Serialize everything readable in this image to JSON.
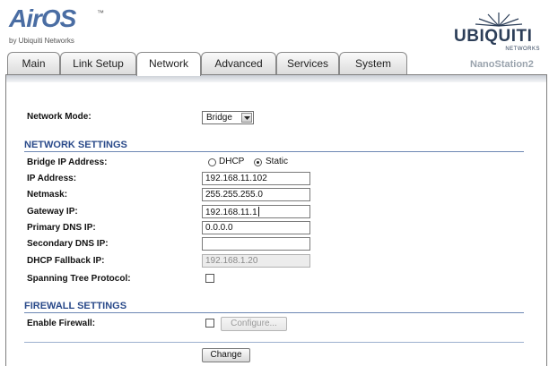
{
  "header": {
    "logo_text": "AirOS",
    "logo_tm": "™",
    "logo_byline": "by Ubiquiti Networks",
    "brand_name": "UBIQUITI",
    "brand_sub": "NETWORKS",
    "device_name": "NanoStation2"
  },
  "tabs": [
    {
      "label": "Main",
      "active": false
    },
    {
      "label": "Link Setup",
      "active": false
    },
    {
      "label": "Network",
      "active": true
    },
    {
      "label": "Advanced",
      "active": false
    },
    {
      "label": "Services",
      "active": false
    },
    {
      "label": "System",
      "active": false
    }
  ],
  "network_mode": {
    "label": "Network Mode:",
    "value": "Bridge"
  },
  "network_settings": {
    "title": "NETWORK SETTINGS",
    "bridge_ip": {
      "label": "Bridge IP Address:",
      "dhcp_label": "DHCP",
      "static_label": "Static",
      "selected": "Static"
    },
    "ip_address": {
      "label": "IP Address:",
      "value": "192.168.11.102"
    },
    "netmask": {
      "label": "Netmask:",
      "value": "255.255.255.0"
    },
    "gateway": {
      "label": "Gateway IP:",
      "value": "192.168.11.1"
    },
    "primary_dns": {
      "label": "Primary DNS IP:",
      "value": "0.0.0.0"
    },
    "secondary_dns": {
      "label": "Secondary DNS IP:",
      "value": ""
    },
    "dhcp_fallback": {
      "label": "DHCP Fallback IP:",
      "value": "192.168.1.20"
    },
    "stp": {
      "label": "Spanning Tree Protocol:",
      "checked": false
    }
  },
  "firewall_settings": {
    "title": "FIREWALL SETTINGS",
    "enable": {
      "label": "Enable Firewall:",
      "checked": false
    },
    "configure_label": "Configure..."
  },
  "change_label": "Change",
  "colors": {
    "accent": "#2a4a8a",
    "logo_blue": "#4a6da3",
    "brand_navy": "#2c3e58",
    "device_grey": "#9aa3ad"
  }
}
